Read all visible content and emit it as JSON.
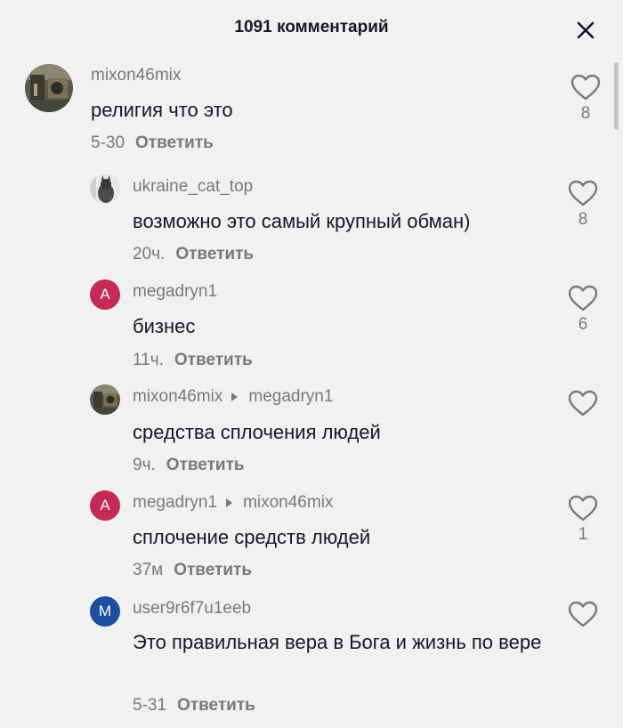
{
  "header": {
    "title": "1091 комментарий",
    "close_icon": "close-icon"
  },
  "colors": {
    "background": "#f1f1f2",
    "text": "#161823",
    "muted": "#78787d",
    "avatar_a": "#c32a58",
    "avatar_m": "#1e4ea0"
  },
  "comments": [
    {
      "username": "mixon46mix",
      "text": "религия что это",
      "time": "5-30",
      "reply_label": "Ответить",
      "likes": "8",
      "avatar": "photo"
    },
    {
      "username": "ukraine_cat_top",
      "text": "возможно это самый крупный обман)",
      "time": "20ч.",
      "reply_label": "Ответить",
      "likes": "8",
      "avatar": "cat-photo"
    },
    {
      "username": "megadryn1",
      "text": "бизнес",
      "time": "11ч.",
      "reply_label": "Ответить",
      "likes": "6",
      "avatar_letter": "A"
    },
    {
      "username": "mixon46mix",
      "reply_to": "megadryn1",
      "text": "средства сплочения людей",
      "time": "9ч.",
      "reply_label": "Ответить",
      "likes": "",
      "avatar": "photo"
    },
    {
      "username": "megadryn1",
      "reply_to": "mixon46mix",
      "text": "сплочение средств людей",
      "time": "37м",
      "reply_label": "Ответить",
      "likes": "1",
      "avatar_letter": "A"
    },
    {
      "username": "user9r6f7u1eeb",
      "text": "Это правильная вера в Бога и жизнь по вере",
      "time": "5-31",
      "reply_label": "Ответить",
      "likes": "",
      "avatar_letter": "M"
    }
  ]
}
